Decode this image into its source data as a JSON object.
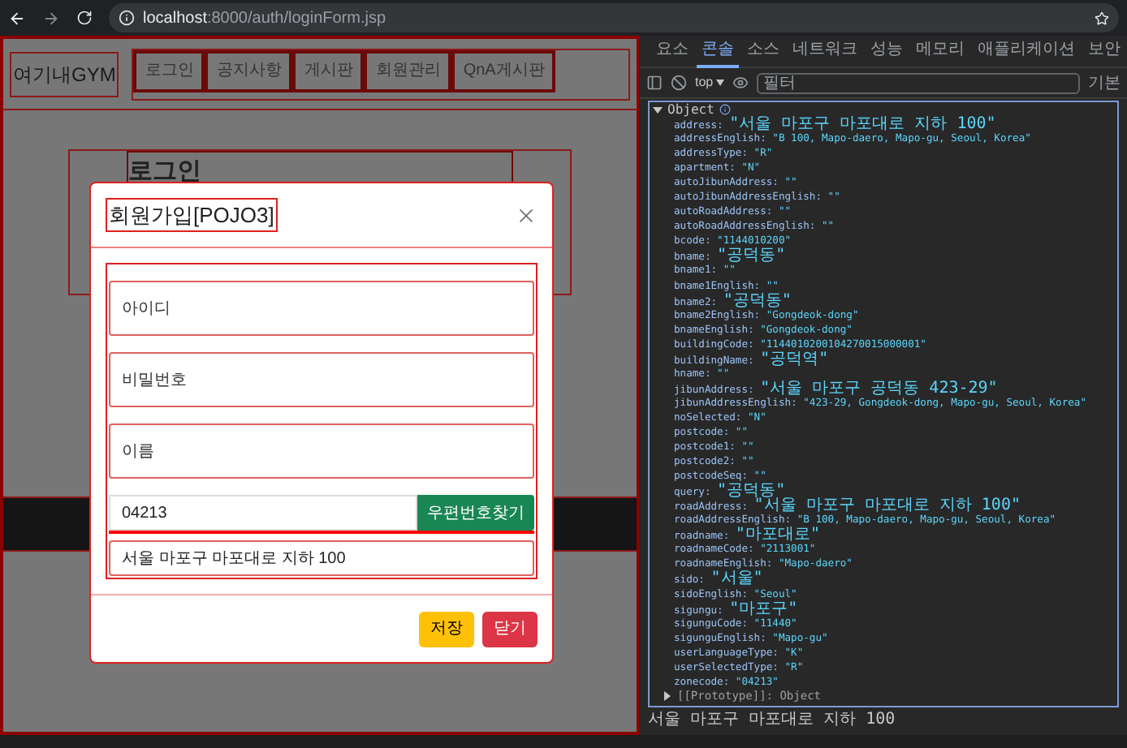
{
  "browser": {
    "url_host": "localhost",
    "url_path": ":8000/auth/loginForm.jsp"
  },
  "page": {
    "brand": "여기내GYM",
    "nav": [
      "로그인",
      "공지사항",
      "게시판",
      "회원관리",
      "QnA게시판"
    ],
    "heading": "로그인"
  },
  "modal": {
    "title": "회원가입[POJO3]",
    "fields": [
      {
        "kind": "input",
        "placeholder": "아이디"
      },
      {
        "kind": "input",
        "placeholder": "비밀번호"
      },
      {
        "kind": "input",
        "placeholder": "이름"
      }
    ],
    "postcode": {
      "value": "04213",
      "button": "우편번호찾기"
    },
    "address": {
      "value": "서울 마포구 마포대로 지하 100"
    },
    "buttons": [
      {
        "label": "저장",
        "kind": "warning"
      },
      {
        "label": "닫기",
        "kind": "danger"
      }
    ]
  },
  "devtools": {
    "tabs": [
      {
        "label": "요소",
        "selected": false
      },
      {
        "label": "콘솔",
        "selected": true
      },
      {
        "label": "소스",
        "selected": false
      },
      {
        "label": "네트워크",
        "selected": false
      },
      {
        "label": "성능",
        "selected": false
      },
      {
        "label": "메모리",
        "selected": false
      },
      {
        "label": "애플리케이션",
        "selected": false
      },
      {
        "label": "보안",
        "selected": false
      }
    ],
    "context": "top",
    "filter_placeholder": "필터",
    "levels": "기본",
    "object": {
      "label": "Object",
      "expanded": true,
      "entries": [
        {
          "key": "address:",
          "value": "\"서울 마포구 마포대로 지하 100\""
        },
        {
          "key": "addressEnglish:",
          "value": "\"B 100, Mapo-daero, Mapo-gu, Seoul, Korea\""
        },
        {
          "key": "addressType:",
          "value": "\"R\""
        },
        {
          "key": "apartment:",
          "value": "\"N\""
        },
        {
          "key": "autoJibunAddress:",
          "value": "\"\""
        },
        {
          "key": "autoJibunAddressEnglish:",
          "value": "\"\""
        },
        {
          "key": "autoRoadAddress:",
          "value": "\"\""
        },
        {
          "key": "autoRoadAddressEnglish:",
          "value": "\"\""
        },
        {
          "key": "bcode:",
          "value": "\"1144010200\""
        },
        {
          "key": "bname:",
          "value": "\"공덕동\""
        },
        {
          "key": "bname1:",
          "value": "\"\""
        },
        {
          "key": "bname1English:",
          "value": "\"\""
        },
        {
          "key": "bname2:",
          "value": "\"공덕동\""
        },
        {
          "key": "bname2English:",
          "value": "\"Gongdeok-dong\""
        },
        {
          "key": "bnameEnglish:",
          "value": "\"Gongdeok-dong\""
        },
        {
          "key": "buildingCode:",
          "value": "\"1144010200104270015000001\""
        },
        {
          "key": "buildingName:",
          "value": "\"공덕역\""
        },
        {
          "key": "hname:",
          "value": "\"\""
        },
        {
          "key": "jibunAddress:",
          "value": "\"서울 마포구 공덕동 423-29\""
        },
        {
          "key": "jibunAddressEnglish:",
          "value": "\"423-29, Gongdeok-dong, Mapo-gu, Seoul, Korea\""
        },
        {
          "key": "noSelected:",
          "value": "\"N\""
        },
        {
          "key": "postcode:",
          "value": "\"\""
        },
        {
          "key": "postcode1:",
          "value": "\"\""
        },
        {
          "key": "postcode2:",
          "value": "\"\""
        },
        {
          "key": "postcodeSeq:",
          "value": "\"\""
        },
        {
          "key": "query:",
          "value": "\"공덕동\""
        },
        {
          "key": "roadAddress:",
          "value": "\"서울 마포구 마포대로 지하 100\""
        },
        {
          "key": "roadAddressEnglish:",
          "value": "\"B 100, Mapo-daero, Mapo-gu, Seoul, Korea\""
        },
        {
          "key": "roadname:",
          "value": "\"마포대로\""
        },
        {
          "key": "roadnameCode:",
          "value": "\"2113001\""
        },
        {
          "key": "roadnameEnglish:",
          "value": "\"Mapo-daero\""
        },
        {
          "key": "sido:",
          "value": "\"서울\""
        },
        {
          "key": "sidoEnglish:",
          "value": "\"Seoul\""
        },
        {
          "key": "sigungu:",
          "value": "\"마포구\""
        },
        {
          "key": "sigunguCode:",
          "value": "\"11440\""
        },
        {
          "key": "sigunguEnglish:",
          "value": "\"Mapo-gu\""
        },
        {
          "key": "userLanguageType:",
          "value": "\"K\""
        },
        {
          "key": "userSelectedType:",
          "value": "\"R\""
        },
        {
          "key": "zonecode:",
          "value": "\"04213\""
        }
      ],
      "prototype": {
        "label": "[[Prototype]]: Object",
        "expanded": false
      }
    },
    "log": "서울 마포구 마포대로 지하 100"
  }
}
